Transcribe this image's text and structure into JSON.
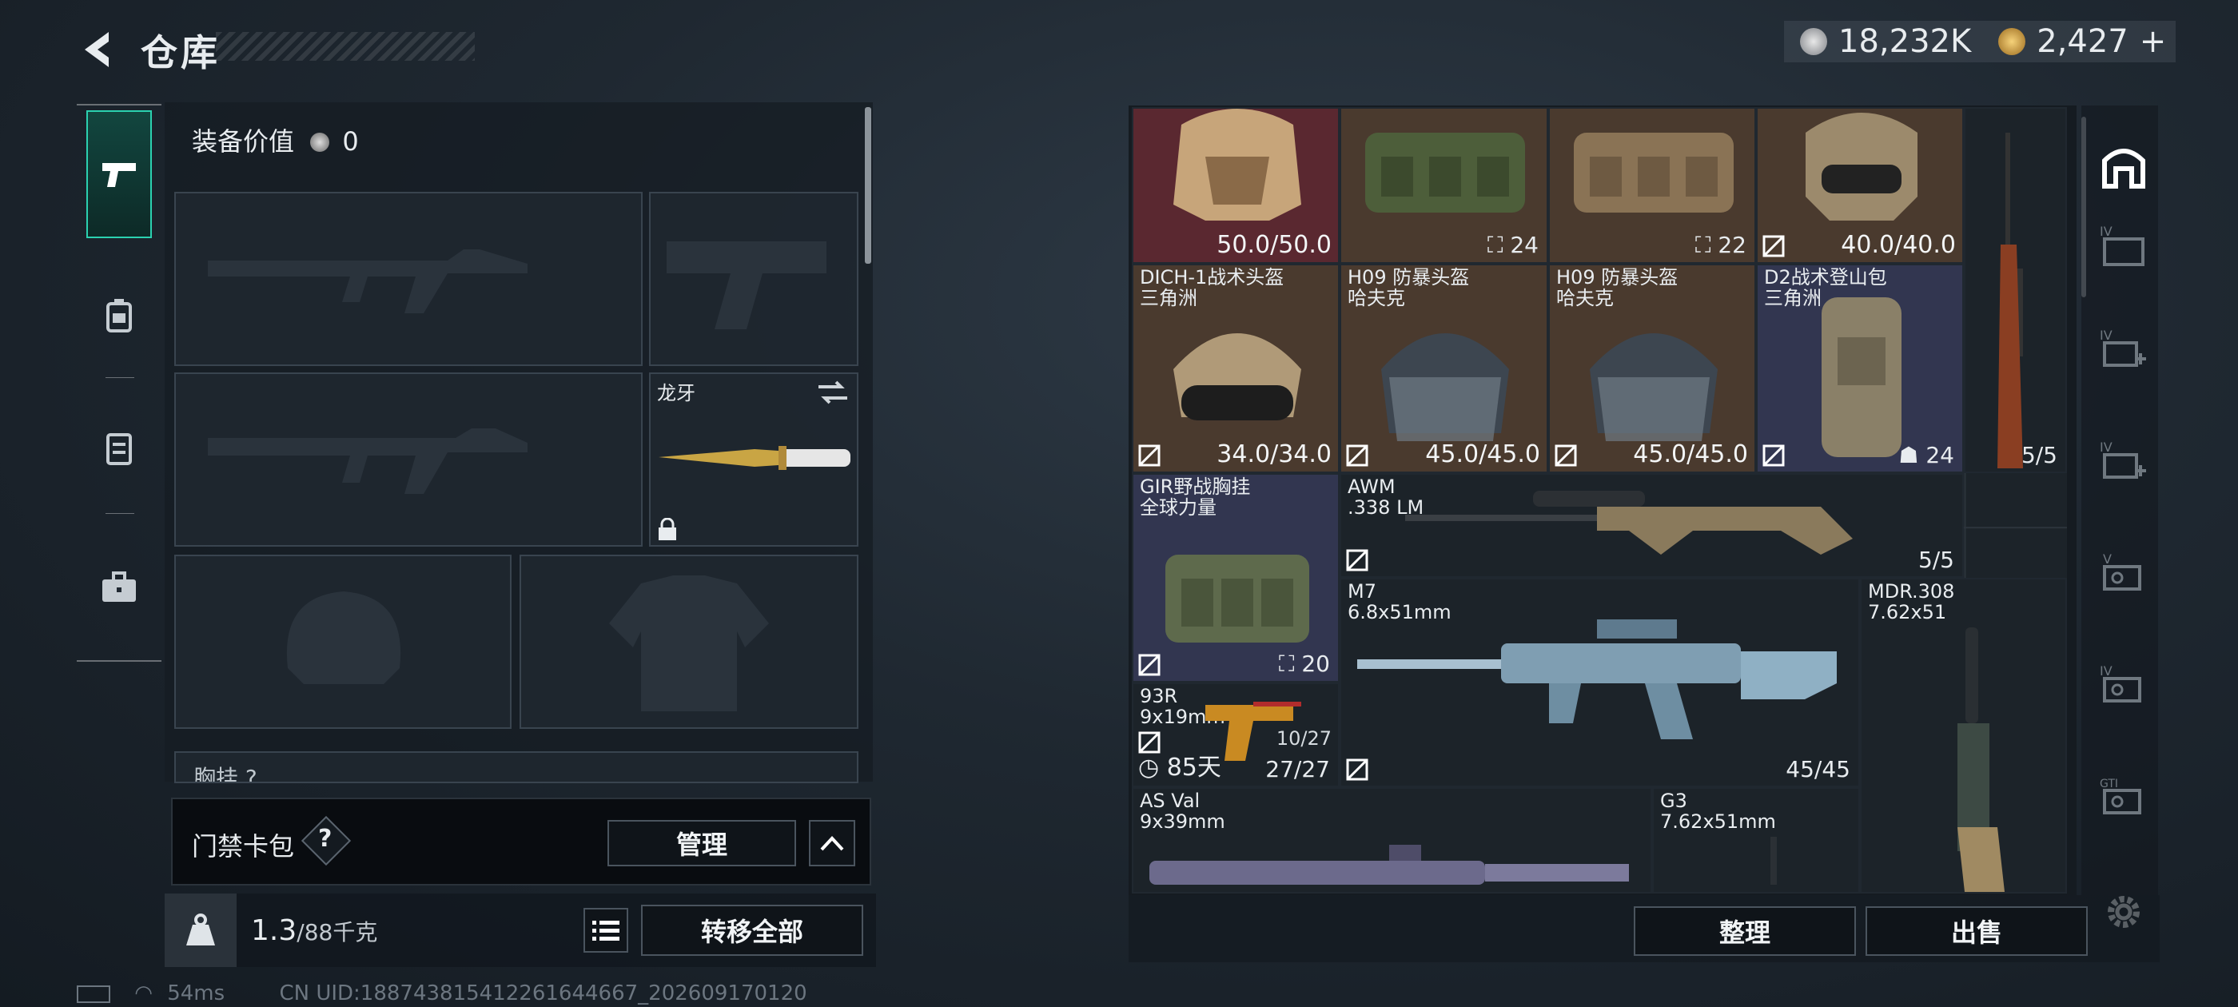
{
  "header": {
    "title": "仓库",
    "currency_silver": "18,232K",
    "currency_gold": "2,427",
    "gold_add": "+"
  },
  "left_tabs": [
    "pistol-tab",
    "backpack-tab",
    "chest-rig-tab",
    "toolbox-tab"
  ],
  "loadout": {
    "equipment_value_label": "装备价值",
    "equipment_value": "0",
    "melee_name": "龙牙",
    "next_section": "胸挂 ?",
    "card_pack_label": "门禁卡包",
    "help": "?",
    "manage": "管理",
    "weight_current": "1.3",
    "weight_max": "/88千克",
    "transfer_all": "转移全部"
  },
  "status": {
    "ping": "54ms",
    "uid": "CN UID:1887438154122616446​67_202609170120"
  },
  "inventory": {
    "items": [
      {
        "id": "helmet-red",
        "durability": "50.0/50.0"
      },
      {
        "id": "bag-green",
        "count": "24"
      },
      {
        "id": "bag-tan",
        "count": "22"
      },
      {
        "id": "helmet-tan",
        "durability": "40.0/40.0"
      },
      {
        "id": "dich1",
        "name": "DICH-1战术头盔",
        "sub": "三角洲",
        "durability": "34.0/34.0"
      },
      {
        "id": "h09a",
        "name": "H09 防暴头盔",
        "sub": "哈夫克",
        "durability": "45.0/45.0"
      },
      {
        "id": "h09b",
        "name": "H09 防暴头盔",
        "sub": "哈夫克",
        "durability": "45.0/45.0"
      },
      {
        "id": "d2",
        "name": "D2战术登山包",
        "sub": "三角洲",
        "count": "24"
      },
      {
        "id": "sniper-tall",
        "count": "5/5"
      },
      {
        "id": "gir",
        "name": "GIR野战胸挂",
        "sub": "全球力量",
        "count": "20"
      },
      {
        "id": "awm",
        "name": "AWM",
        "sub": ".338 LM",
        "count": "5/5"
      },
      {
        "id": "m7",
        "name": "M7",
        "sub": "6.8x51mm",
        "count": "45/45"
      },
      {
        "id": "mdr",
        "name": "MDR.308",
        "sub": "7.62x51"
      },
      {
        "id": "93r",
        "name": "93R",
        "sub": "9x19mm",
        "count": "27/27",
        "mag": "10/27",
        "timer": "85天"
      },
      {
        "id": "asval",
        "name": "AS Val",
        "sub": "9x39mm"
      },
      {
        "id": "g3",
        "name": "G3",
        "sub": "7.62x51mm"
      }
    ],
    "sort": "整理",
    "sell": "出售"
  },
  "right_tabs": [
    "home-tab",
    "iv-container-tab",
    "iv-add-tab",
    "iv-add-tab-2",
    "v-key-tab",
    "iv-key-tab",
    "gti-key-tab",
    "settings-tab"
  ],
  "colors": {
    "accent": "#2bd1b0",
    "red_bg": "#5a2830",
    "brown_bg": "#4a3a2e",
    "purple_bg": "#323650"
  }
}
